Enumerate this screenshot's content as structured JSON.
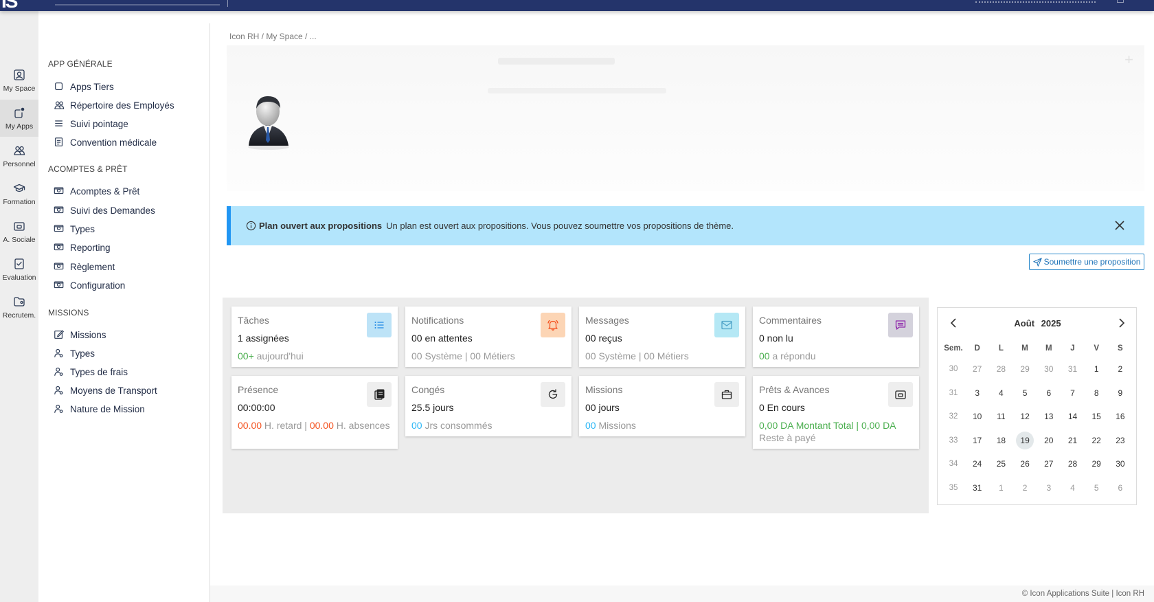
{
  "topbar": {
    "logo_text": "IS"
  },
  "rail": {
    "items": [
      {
        "label": "My Space",
        "icon": "person-card-icon"
      },
      {
        "label": "My Apps",
        "icon": "apps-icon"
      },
      {
        "label": "Personnel",
        "icon": "people-icon"
      },
      {
        "label": "Formation",
        "icon": "graduation-cap-icon"
      },
      {
        "label": "A. Sociale",
        "icon": "wallet-icon"
      },
      {
        "label": "Evaluation",
        "icon": "checklist-icon"
      },
      {
        "label": "Recrutem.",
        "icon": "folder-user-icon"
      }
    ],
    "active": "My Apps"
  },
  "menu": {
    "sections": [
      {
        "title": "APP GÉNÉRALE",
        "items": [
          {
            "label": "Apps Tiers",
            "icon": "square-icon"
          },
          {
            "label": "Répertoire des Employés",
            "icon": "people-icon"
          },
          {
            "label": "Suivi pointage",
            "icon": "list-icon"
          },
          {
            "label": "Convention médicale",
            "icon": "document-icon"
          }
        ]
      },
      {
        "title": "ACOMPTES & PRÊT",
        "items": [
          {
            "label": "Acomptes & Prêt",
            "icon": "cash-icon"
          },
          {
            "label": "Suivi des Demandes",
            "icon": "cash-icon"
          },
          {
            "label": "Types",
            "icon": "cash-icon"
          },
          {
            "label": "Reporting",
            "icon": "cash-icon"
          },
          {
            "label": "Règlement",
            "icon": "cash-icon"
          },
          {
            "label": "Configuration",
            "icon": "cash-icon"
          }
        ]
      },
      {
        "title": "MISSIONS",
        "items": [
          {
            "label": "Missions",
            "icon": "edit-icon"
          },
          {
            "label": "Types",
            "icon": "person-gear-icon"
          },
          {
            "label": "Types de frais",
            "icon": "person-gear-icon"
          },
          {
            "label": "Moyens de Transport",
            "icon": "person-gear-icon"
          },
          {
            "label": "Nature de Mission",
            "icon": "person-gear-icon"
          }
        ]
      }
    ]
  },
  "breadcrumb": "Icon RH / My Space / ...",
  "alert": {
    "title": "Plan ouvert aux propositions",
    "message": "Un plan est ouvert aux propositions. Vous pouvez soumettre vos propositions de thème."
  },
  "submit_button": "Soumettre une proposition",
  "stats": [
    {
      "title": "Tâches",
      "value": "1 assignées",
      "sub": [
        [
          "00+",
          "green"
        ],
        [
          " aujourd'hui",
          ""
        ]
      ],
      "icon": "task-list-icon",
      "icon_bg": "#bde3f7",
      "icon_color": "#1e88e5"
    },
    {
      "title": "Notifications",
      "value": "00 en attentes",
      "sub": [
        [
          "00 Système | 00 Métiers",
          ""
        ]
      ],
      "icon": "bell-icon",
      "icon_bg": "#fcd5b5",
      "icon_color": "#f4511e"
    },
    {
      "title": "Messages",
      "value": "00 reçus",
      "sub": [
        [
          "00 Système | 00 Métiers",
          ""
        ]
      ],
      "icon": "mail-icon",
      "icon_bg": "#b5e8f5",
      "icon_color": "#4fa3c8"
    },
    {
      "title": "Commentaires",
      "value": "0 non lu",
      "sub": [
        [
          "00",
          "green"
        ],
        [
          " a répondu",
          ""
        ]
      ],
      "icon": "comment-icon",
      "icon_bg": "#d4d2dc",
      "icon_color": "#8e24aa"
    },
    {
      "title": "Présence",
      "value": "00:00:00",
      "sub": [
        [
          "00.00",
          "red"
        ],
        [
          " H. retard | ",
          ""
        ],
        [
          "00.00",
          "red"
        ],
        [
          " H. absences",
          ""
        ]
      ],
      "icon": "clock-card-icon",
      "icon_bg": "#eeeeee",
      "icon_color": "#222"
    },
    {
      "title": "Congés",
      "value": "25.5 jours",
      "sub": [
        [
          "00",
          "blue"
        ],
        [
          " Jrs consommés",
          ""
        ]
      ],
      "icon": "refresh-icon",
      "icon_bg": "#eeeeee",
      "icon_color": "#222"
    },
    {
      "title": "Missions",
      "value": "00 jours",
      "sub": [
        [
          "00",
          "blue"
        ],
        [
          " Missions",
          ""
        ]
      ],
      "icon": "briefcase-icon",
      "icon_bg": "#eeeeee",
      "icon_color": "#222"
    },
    {
      "title": "Prêts & Avances",
      "value": "0 En cours",
      "sub": [
        [
          "0,00 DA",
          "green"
        ],
        [
          " Montant Total | ",
          "green"
        ],
        [
          "0,00 DA",
          "green"
        ],
        [
          " Reste à payé",
          ""
        ]
      ],
      "icon": "wallet-icon",
      "icon_bg": "#eeeeee",
      "icon_color": "#222"
    }
  ],
  "calendar": {
    "month": "Août",
    "year": "2025",
    "headers": [
      "Sem.",
      "D",
      "L",
      "M",
      "M",
      "J",
      "V",
      "S"
    ],
    "weeks": [
      {
        "wk": "30",
        "days": [
          "27",
          "28",
          "29",
          "30",
          "31",
          "1",
          "2"
        ],
        "other": [
          true,
          true,
          true,
          true,
          true,
          false,
          false
        ]
      },
      {
        "wk": "31",
        "days": [
          "3",
          "4",
          "5",
          "6",
          "7",
          "8",
          "9"
        ],
        "other": [
          false,
          false,
          false,
          false,
          false,
          false,
          false
        ]
      },
      {
        "wk": "32",
        "days": [
          "10",
          "11",
          "12",
          "13",
          "14",
          "15",
          "16"
        ],
        "other": [
          false,
          false,
          false,
          false,
          false,
          false,
          false
        ]
      },
      {
        "wk": "33",
        "days": [
          "17",
          "18",
          "19",
          "20",
          "21",
          "22",
          "23"
        ],
        "other": [
          false,
          false,
          false,
          false,
          false,
          false,
          false
        ]
      },
      {
        "wk": "34",
        "days": [
          "24",
          "25",
          "26",
          "27",
          "28",
          "29",
          "30"
        ],
        "other": [
          false,
          false,
          false,
          false,
          false,
          false,
          false
        ]
      },
      {
        "wk": "35",
        "days": [
          "31",
          "1",
          "2",
          "3",
          "4",
          "5",
          "6"
        ],
        "other": [
          false,
          true,
          true,
          true,
          true,
          true,
          true
        ]
      }
    ],
    "today": "19"
  },
  "footer": "© Icon Applications Suite | Icon RH"
}
